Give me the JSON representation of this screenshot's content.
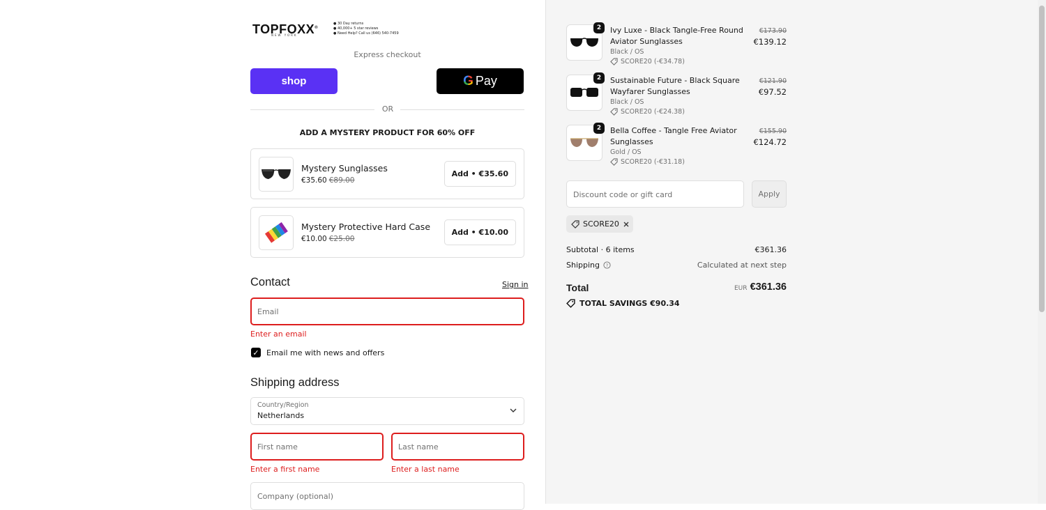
{
  "brand": {
    "name": "TOPFOXX",
    "registered": "®",
    "city": "NEW YORK",
    "info": [
      "30 Day returns",
      "40,000+ 5 star reviews",
      "Need Help? Call us (646) 540-7459"
    ]
  },
  "express": {
    "label": "Express checkout",
    "shop_label": "shop",
    "gpay_label": "Pay",
    "or_label": "OR"
  },
  "upsell": {
    "title": "ADD A MYSTERY PRODUCT FOR 60% OFF",
    "items": [
      {
        "name": "Mystery Sunglasses",
        "price": "€35.60",
        "old_price": "€89.00",
        "button": "Add • €35.60"
      },
      {
        "name": "Mystery Protective Hard Case",
        "price": "€10.00",
        "old_price": "€25.00",
        "button": "Add • €10.00"
      }
    ]
  },
  "contact": {
    "title": "Contact",
    "sign_in": "Sign in",
    "email_placeholder": "Email",
    "email_error": "Enter an email",
    "newsletter_label": "Email me with news and offers",
    "newsletter_checked": true
  },
  "shipping": {
    "title": "Shipping address",
    "country_label": "Country/Region",
    "country_value": "Netherlands",
    "first_name_placeholder": "First name",
    "first_name_error": "Enter a first name",
    "last_name_placeholder": "Last name",
    "last_name_error": "Enter a last name",
    "company_placeholder": "Company (optional)"
  },
  "cart": {
    "items": [
      {
        "qty": "2",
        "name": "Ivy Luxe - Black Tangle-Free Round Aviator Sunglasses",
        "variant": "Black / OS",
        "discount": "SCORE20 (-€34.78)",
        "old_price": "€173.90",
        "price": "€139.12"
      },
      {
        "qty": "2",
        "name": "Sustainable Future - Black Square Wayfarer Sunglasses",
        "variant": "Black / OS",
        "discount": "SCORE20 (-€24.38)",
        "old_price": "€121.90",
        "price": "€97.52"
      },
      {
        "qty": "2",
        "name": "Bella Coffee - Tangle Free Aviator Sunglasses",
        "variant": "Gold / OS",
        "discount": "SCORE20 (-€31.18)",
        "old_price": "€155.90",
        "price": "€124.72"
      }
    ],
    "discount_placeholder": "Discount code or gift card",
    "apply_label": "Apply",
    "applied_code": "SCORE20",
    "subtotal_label": "Subtotal · 6 items",
    "subtotal_value": "€361.36",
    "shipping_label": "Shipping",
    "shipping_value": "Calculated at next step",
    "total_label": "Total",
    "total_currency": "EUR",
    "total_value": "€361.36",
    "savings_label": "TOTAL SAVINGS €90.34"
  },
  "colors": {
    "shop_purple": "#5a31f4",
    "error_red": "#dd1d1d",
    "panel_gray": "#f5f5f5"
  }
}
